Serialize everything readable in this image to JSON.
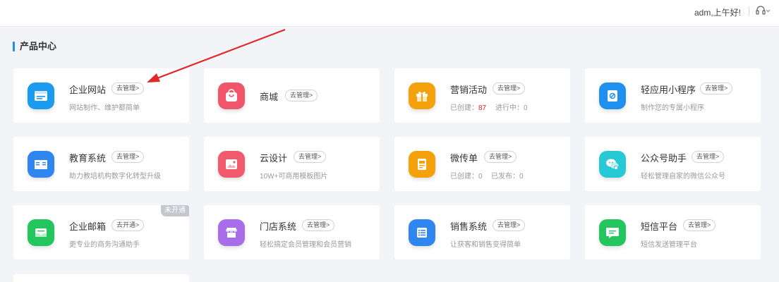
{
  "header": {
    "greeting": "adm,上午好!"
  },
  "section": {
    "title": "产品中心"
  },
  "cards": [
    {
      "title": "企业网站",
      "action": "去管理>",
      "desc": "网站制作、维护都简单",
      "icon": "website-icon",
      "color": "#1a9bf0"
    },
    {
      "title": "商城",
      "action": "去管理>",
      "icon": "shopping-bag-icon",
      "color": "#f0566a"
    },
    {
      "title": "营销活动",
      "action": "去管理>",
      "desc_a": "已创建：",
      "desc_a_value": "87",
      "desc_b": "进行中：0",
      "icon": "gift-icon",
      "color": "#f5a10c"
    },
    {
      "title": "轻应用小程序",
      "action": "去管理>",
      "desc": "制作您的专属小程序",
      "icon": "mini-program-icon",
      "color": "#1f8ff0"
    },
    {
      "title": "教育系统",
      "action": "去管理>",
      "desc": "助力教培机构数字化转型升级",
      "icon": "book-icon",
      "color": "#2f86f0"
    },
    {
      "title": "云设计",
      "action": "去管理>",
      "desc": "10W+可商用模板图片",
      "icon": "image-icon",
      "color": "#f05a6c"
    },
    {
      "title": "微传单",
      "action": "去管理>",
      "desc_a": "已创建：0",
      "desc_b": "已发布：0",
      "icon": "flyer-icon",
      "color": "#f5a10c"
    },
    {
      "title": "公众号助手",
      "action": "去管理>",
      "desc": "轻松管理自家的微信公众号",
      "icon": "wechat-icon",
      "color": "#27c9d6"
    },
    {
      "title": "企业邮箱",
      "action": "去开通>",
      "desc": "更专业的商务沟通助手",
      "badge": "未开通",
      "icon": "mail-icon",
      "color": "#22c55e"
    },
    {
      "title": "门店系统",
      "action": "去管理>",
      "desc": "轻松搞定会员管理和会员营销",
      "icon": "store-icon",
      "color": "#a86de8"
    },
    {
      "title": "销售系统",
      "action": "去管理>",
      "desc": "让获客和销售变得简单",
      "icon": "list-icon",
      "color": "#2f86f0"
    },
    {
      "title": "短信平台",
      "action": "去管理>",
      "desc": "短信发送管理平台",
      "icon": "message-icon",
      "color": "#22c55e"
    }
  ]
}
